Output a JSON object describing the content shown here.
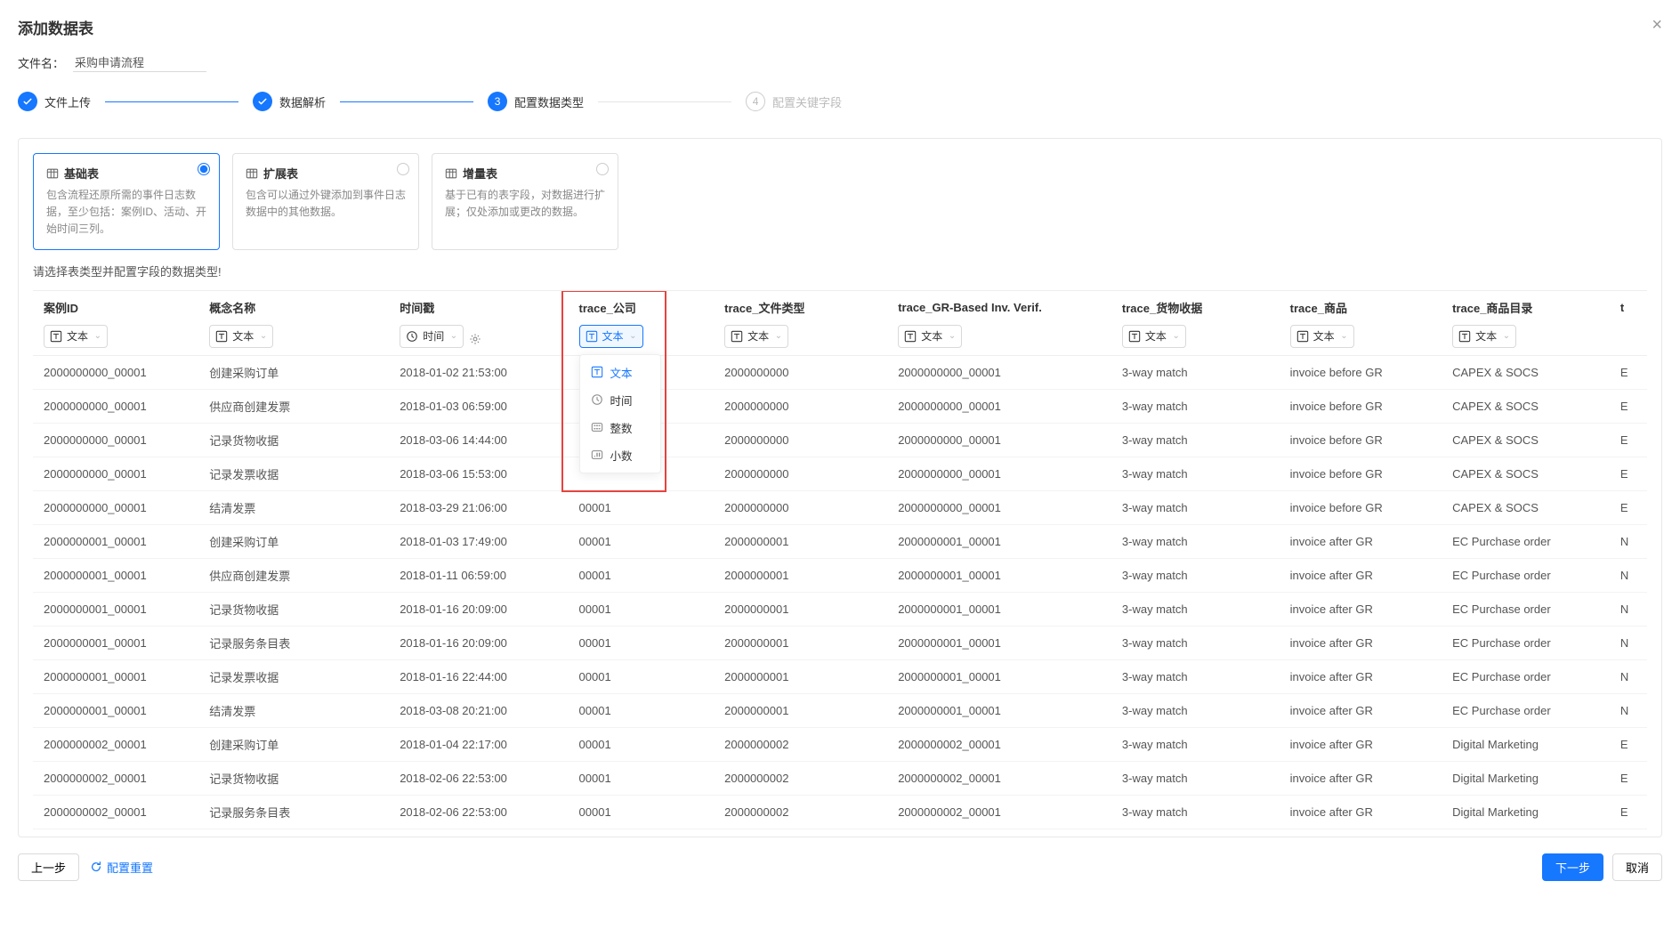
{
  "modal": {
    "title": "添加数据表",
    "filename_label": "文件名：",
    "filename_value": "采购申请流程"
  },
  "steps": [
    {
      "label": "文件上传",
      "state": "done"
    },
    {
      "label": "数据解析",
      "state": "done"
    },
    {
      "label": "配置数据类型",
      "state": "current",
      "num": "3"
    },
    {
      "label": "配置关键字段",
      "state": "pending",
      "num": "4"
    }
  ],
  "type_cards": [
    {
      "title": "基础表",
      "desc": "包含流程还原所需的事件日志数据，至少包括：案例ID、活动、开始时间三列。",
      "icon": "table-icon",
      "selected": true
    },
    {
      "title": "扩展表",
      "desc": "包含可以通过外键添加到事件日志数据中的其他数据。",
      "icon": "table-icon",
      "selected": false
    },
    {
      "title": "增量表",
      "desc": "基于已有的表字段，对数据进行扩展；仅处添加或更改的数据。",
      "icon": "table-icon",
      "selected": false
    }
  ],
  "helper_text": "请选择表类型并配置字段的数据类型!",
  "columns": [
    {
      "header": "案例ID",
      "selector": {
        "icon": "text",
        "label": "文本"
      }
    },
    {
      "header": "概念名称",
      "selector": {
        "icon": "text",
        "label": "文本"
      }
    },
    {
      "header": "时间戳",
      "selector": {
        "icon": "time",
        "label": "时间",
        "gear": true
      }
    },
    {
      "header": "trace_公司",
      "selector": {
        "icon": "text",
        "label": "文本",
        "active": true,
        "dropdown_open": true
      },
      "highlight": true
    },
    {
      "header": "trace_文件类型",
      "selector": {
        "icon": "text",
        "label": "文本"
      }
    },
    {
      "header": "trace_GR-Based Inv. Verif.",
      "selector": {
        "icon": "text",
        "label": "文本"
      }
    },
    {
      "header": "trace_货物收据",
      "selector": {
        "icon": "text",
        "label": "文本"
      }
    },
    {
      "header": "trace_商品",
      "selector": {
        "icon": "text",
        "label": "文本"
      }
    },
    {
      "header": "trace_商品目录",
      "selector": {
        "icon": "text",
        "label": "文本"
      }
    },
    {
      "header": "t"
    }
  ],
  "dropdown_options": [
    {
      "icon": "text",
      "label": "文本",
      "selected": true
    },
    {
      "icon": "time",
      "label": "时间"
    },
    {
      "icon": "int",
      "label": "整数"
    },
    {
      "icon": "dec",
      "label": "小数"
    }
  ],
  "rows": [
    [
      "2000000000_00001",
      "创建采购订单",
      "2018-01-02 21:53:00",
      "",
      "2000000000",
      "2000000000_00001",
      "3-way match",
      "invoice before GR",
      "CAPEX & SOCS",
      "E"
    ],
    [
      "2000000000_00001",
      "供应商创建发票",
      "2018-01-03 06:59:00",
      "",
      "2000000000",
      "2000000000_00001",
      "3-way match",
      "invoice before GR",
      "CAPEX & SOCS",
      "E"
    ],
    [
      "2000000000_00001",
      "记录货物收据",
      "2018-03-06 14:44:00",
      "",
      "2000000000",
      "2000000000_00001",
      "3-way match",
      "invoice before GR",
      "CAPEX & SOCS",
      "E"
    ],
    [
      "2000000000_00001",
      "记录发票收据",
      "2018-03-06 15:53:00",
      "",
      "2000000000",
      "2000000000_00001",
      "3-way match",
      "invoice before GR",
      "CAPEX & SOCS",
      "E"
    ],
    [
      "2000000000_00001",
      "结清发票",
      "2018-03-29 21:06:00",
      "00001",
      "2000000000",
      "2000000000_00001",
      "3-way match",
      "invoice before GR",
      "CAPEX & SOCS",
      "E"
    ],
    [
      "2000000001_00001",
      "创建采购订单",
      "2018-01-03 17:49:00",
      "00001",
      "2000000001",
      "2000000001_00001",
      "3-way match",
      "invoice after GR",
      "EC Purchase order",
      "N"
    ],
    [
      "2000000001_00001",
      "供应商创建发票",
      "2018-01-11 06:59:00",
      "00001",
      "2000000001",
      "2000000001_00001",
      "3-way match",
      "invoice after GR",
      "EC Purchase order",
      "N"
    ],
    [
      "2000000001_00001",
      "记录货物收据",
      "2018-01-16 20:09:00",
      "00001",
      "2000000001",
      "2000000001_00001",
      "3-way match",
      "invoice after GR",
      "EC Purchase order",
      "N"
    ],
    [
      "2000000001_00001",
      "记录服务条目表",
      "2018-01-16 20:09:00",
      "00001",
      "2000000001",
      "2000000001_00001",
      "3-way match",
      "invoice after GR",
      "EC Purchase order",
      "N"
    ],
    [
      "2000000001_00001",
      "记录发票收据",
      "2018-01-16 22:44:00",
      "00001",
      "2000000001",
      "2000000001_00001",
      "3-way match",
      "invoice after GR",
      "EC Purchase order",
      "N"
    ],
    [
      "2000000001_00001",
      "结清发票",
      "2018-03-08 20:21:00",
      "00001",
      "2000000001",
      "2000000001_00001",
      "3-way match",
      "invoice after GR",
      "EC Purchase order",
      "N"
    ],
    [
      "2000000002_00001",
      "创建采购订单",
      "2018-01-04 22:17:00",
      "00001",
      "2000000002",
      "2000000002_00001",
      "3-way match",
      "invoice after GR",
      "Digital Marketing",
      "E"
    ],
    [
      "2000000002_00001",
      "记录货物收据",
      "2018-02-06 22:53:00",
      "00001",
      "2000000002",
      "2000000002_00001",
      "3-way match",
      "invoice after GR",
      "Digital Marketing",
      "E"
    ],
    [
      "2000000002_00001",
      "记录服务条目表",
      "2018-02-06 22:53:00",
      "00001",
      "2000000002",
      "2000000002_00001",
      "3-way match",
      "invoice after GR",
      "Digital Marketing",
      "E"
    ]
  ],
  "footer": {
    "prev": "上一步",
    "reset": "配置重置",
    "next": "下一步",
    "cancel": "取消"
  }
}
